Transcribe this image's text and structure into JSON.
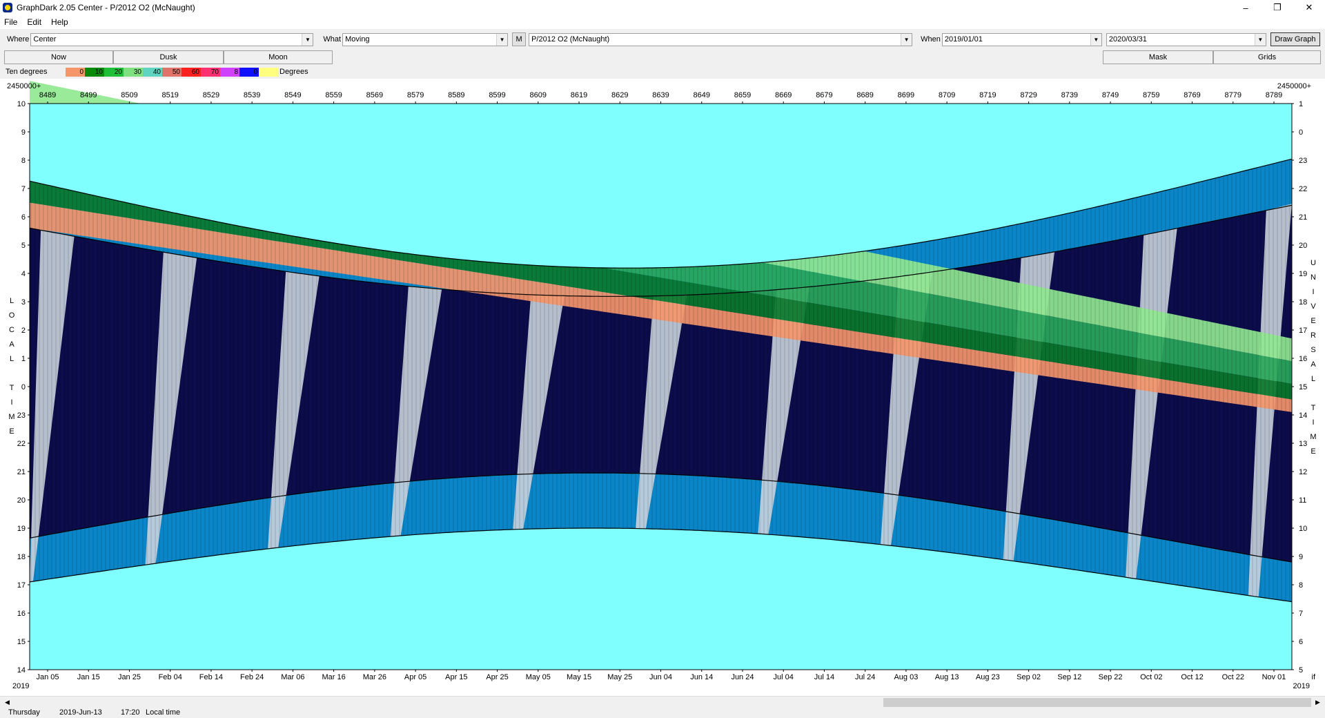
{
  "window": {
    "title": "GraphDark 2.05  Center  -  P/2012 O2 (McNaught)",
    "minimize": "–",
    "restore": "❐",
    "close": "✕"
  },
  "menu": [
    "File",
    "Edit",
    "Help"
  ],
  "toolbar": {
    "where_label": "Where",
    "where_value": "Center",
    "what_label": "What",
    "what_value": "Moving",
    "m_button": "M",
    "object_value": "P/2012 O2 (McNaught)",
    "when_label": "When",
    "start_date": "2019/01/01",
    "end_date": "2020/03/31",
    "draw_button": "Draw Graph"
  },
  "tabs": {
    "now": "Now",
    "dusk": "Dusk",
    "moon": "Moon",
    "mask": "Mask",
    "grids": "Grids"
  },
  "legend": {
    "title": "Ten degrees",
    "unit": "Degrees",
    "items": [
      {
        "label": "0",
        "color": "#f4956a"
      },
      {
        "label": "10",
        "color": "#0a8a0a"
      },
      {
        "label": "20",
        "color": "#1fbf3a"
      },
      {
        "label": "30",
        "color": "#7fe07f"
      },
      {
        "label": "40",
        "color": "#5fd4c0"
      },
      {
        "label": "50",
        "color": "#e2736b"
      },
      {
        "label": "60",
        "color": "#ff2020"
      },
      {
        "label": "70",
        "color": "#ff3070"
      },
      {
        "label": "8",
        "color": "#d040ff"
      },
      {
        "label": "0",
        "color": "#1010ff"
      },
      {
        "label": "",
        "color": "#ffff80"
      }
    ]
  },
  "plot": {
    "top_left_label": "2450000+",
    "top_right_label": "2450000+",
    "jd_ticks": [
      "8489",
      "8499",
      "8509",
      "8519",
      "8529",
      "8539",
      "8549",
      "8559",
      "8569",
      "8579",
      "8589",
      "8599",
      "8609",
      "8619",
      "8629",
      "8639",
      "8649",
      "8659",
      "8669",
      "8679",
      "8689",
      "8699",
      "8709",
      "8719",
      "8729",
      "8739",
      "8749",
      "8759",
      "8769",
      "8779",
      "8789"
    ],
    "date_ticks": [
      "Jan 05",
      "Jan 15",
      "Jan 25",
      "Feb 04",
      "Feb 14",
      "Feb 24",
      "Mar 06",
      "Mar 16",
      "Mar 26",
      "Apr 05",
      "Apr 15",
      "Apr 25",
      "May 05",
      "May 15",
      "May 25",
      "Jun 04",
      "Jun 14",
      "Jun 24",
      "Jul 04",
      "Jul 14",
      "Jul 24",
      "Aug 03",
      "Aug 13",
      "Aug 23",
      "Sep 02",
      "Sep 12",
      "Sep 22",
      "Oct 02",
      "Oct 12",
      "Oct 22",
      "Nov 01"
    ],
    "year_left": "2019",
    "year_right": "2019",
    "bottom_right_small": "if",
    "left_ticks": [
      "10",
      "9",
      "8",
      "7",
      "6",
      "5",
      "4",
      "3",
      "2",
      "1",
      "0",
      "23",
      "22",
      "21",
      "20",
      "19",
      "18",
      "17",
      "16",
      "15",
      "14"
    ],
    "right_ticks": [
      "1",
      "0",
      "23",
      "22",
      "21",
      "20",
      "19",
      "18",
      "17",
      "16",
      "15",
      "14",
      "13",
      "12",
      "11",
      "10",
      "9",
      "8",
      "7",
      "6",
      "5"
    ],
    "left_axis_letters": [
      "L",
      "O",
      "C",
      "A",
      "L",
      "",
      "T",
      "I",
      "M",
      "E"
    ],
    "right_axis_letters": [
      "U",
      "N",
      "I",
      "V",
      "E",
      "R",
      "S",
      "A",
      "L",
      "",
      "T",
      "I",
      "M",
      "E"
    ],
    "colors": {
      "day": "#80ffff",
      "night": "#0c0c4a",
      "twilight": "#0a86c8",
      "moon": "#c8d2dc",
      "alt0": "#f4956a",
      "alt10": "#0a7a2a",
      "alt20": "#2aa85a",
      "alt30": "#90e890"
    }
  },
  "status": {
    "weekday": "Thursday",
    "date": "2019-Jun-13",
    "time": "17:20",
    "tz": "Local time"
  },
  "scroll": {
    "left_arrow": "◀",
    "right_arrow": "▶"
  }
}
